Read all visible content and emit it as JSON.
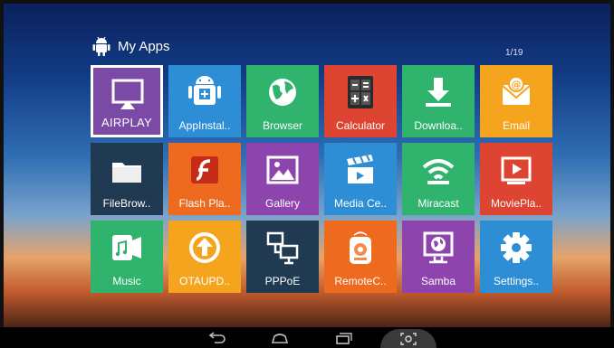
{
  "header": {
    "title": "My Apps",
    "icon": "android-icon"
  },
  "page_indicator": "1/19",
  "colors": {
    "purple": "#8e44ad",
    "blue": "#2d8ed6",
    "green": "#2fb36d",
    "red": "#de4432",
    "orange": "#f5a51d",
    "navy": "#203a52",
    "deeporange": "#ed6a1f"
  },
  "apps": [
    {
      "label": "AIRPLAY",
      "icon": "airplay-icon",
      "color": "#7b4aa6",
      "selected": true
    },
    {
      "label": "AppInstal..",
      "icon": "app-installer-icon",
      "color": "#2d8ed6"
    },
    {
      "label": "Browser",
      "icon": "globe-icon",
      "color": "#2fb36d"
    },
    {
      "label": "Calculator",
      "icon": "calculator-icon",
      "color": "#de4432"
    },
    {
      "label": "Downloa..",
      "icon": "download-icon",
      "color": "#2fb36d"
    },
    {
      "label": "Email",
      "icon": "email-icon",
      "color": "#f5a51d"
    },
    {
      "label": "FileBrow..",
      "icon": "folder-icon",
      "color": "#203a52"
    },
    {
      "label": "Flash Pla..",
      "icon": "flash-icon",
      "color": "#ed6a1f"
    },
    {
      "label": "Gallery",
      "icon": "gallery-icon",
      "color": "#8e44ad"
    },
    {
      "label": "Media Ce..",
      "icon": "clapperboard-icon",
      "color": "#2d8ed6"
    },
    {
      "label": "Miracast",
      "icon": "wifi-icon",
      "color": "#2fb36d"
    },
    {
      "label": "MoviePla..",
      "icon": "play-icon",
      "color": "#de4432"
    },
    {
      "label": "Music",
      "icon": "music-icon",
      "color": "#2fb36d"
    },
    {
      "label": "OTAUPD..",
      "icon": "update-icon",
      "color": "#f5a51d"
    },
    {
      "label": "PPPoE",
      "icon": "network-icon",
      "color": "#203a52"
    },
    {
      "label": "RemoteC..",
      "icon": "remote-icon",
      "color": "#ed6a1f"
    },
    {
      "label": "Samba",
      "icon": "samba-icon",
      "color": "#8e44ad"
    },
    {
      "label": "Settings..",
      "icon": "gear-icon",
      "color": "#2d8ed6"
    }
  ],
  "navbar": [
    {
      "icon": "back-icon"
    },
    {
      "icon": "home-icon"
    },
    {
      "icon": "recents-icon"
    },
    {
      "icon": "screenshot-icon"
    }
  ]
}
